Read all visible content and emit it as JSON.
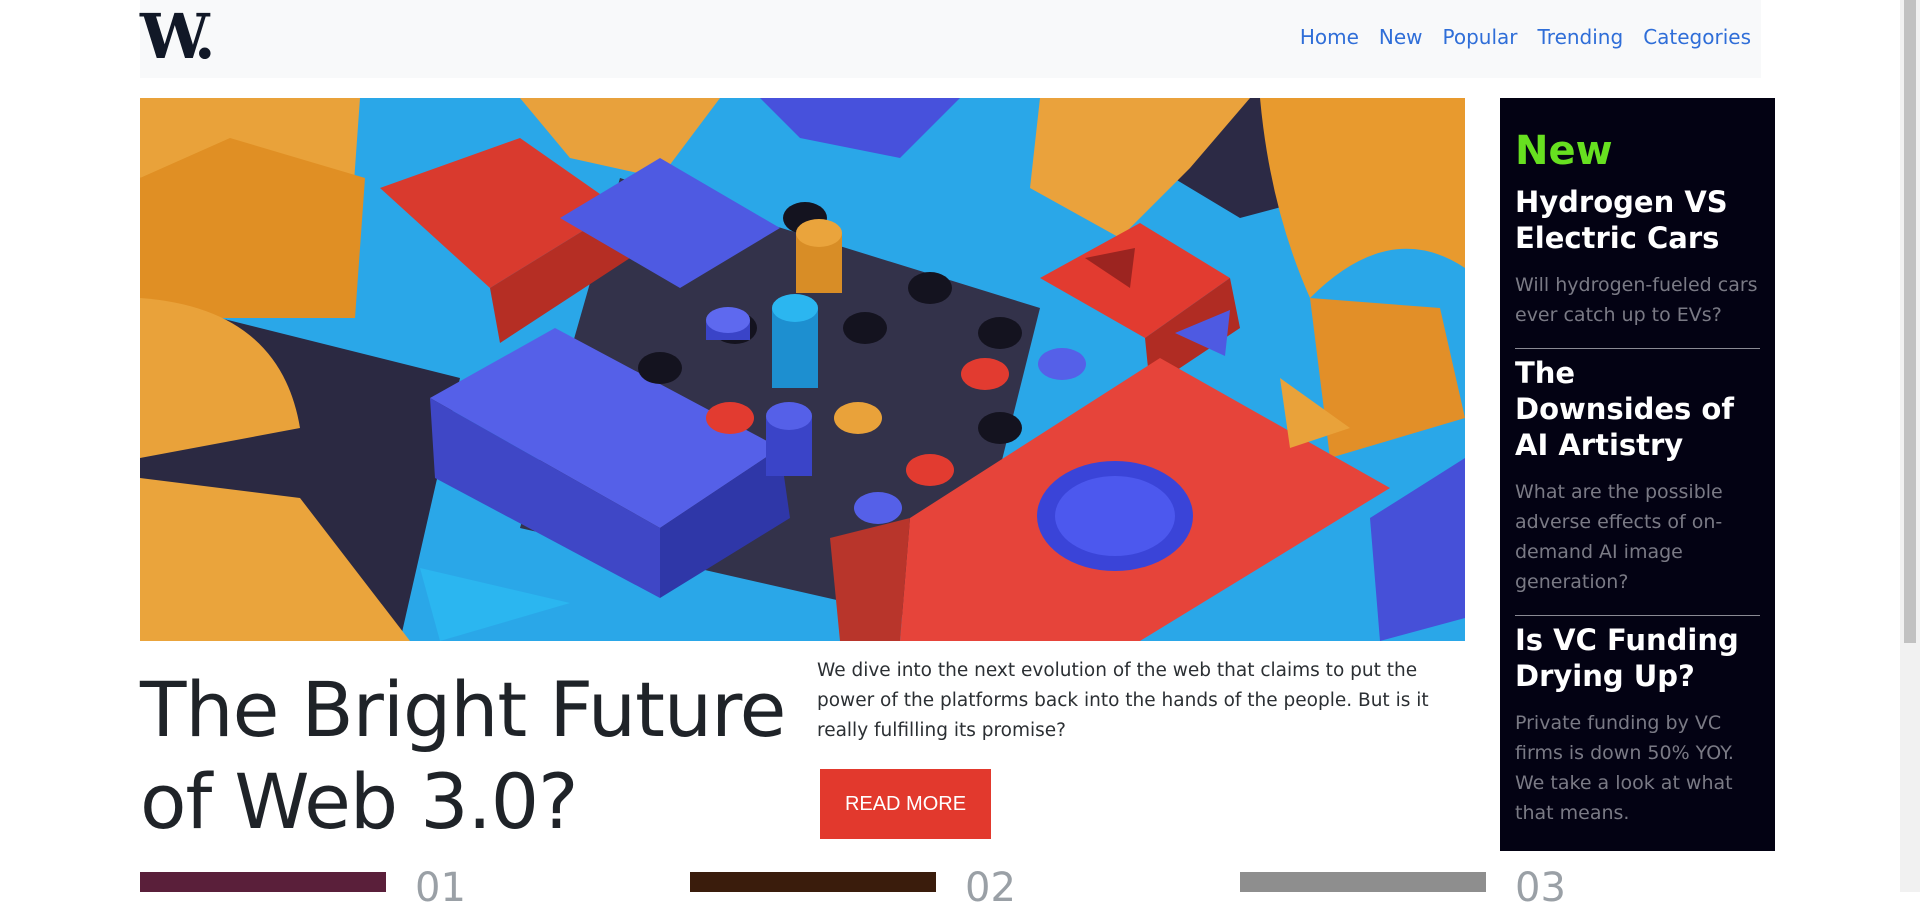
{
  "nav": {
    "logo": "W.",
    "links": [
      "Home",
      "New",
      "Popular",
      "Trending",
      "Categories"
    ]
  },
  "hero": {
    "title": "The Bright Future of Web 3.0?",
    "description": "We dive into the next evolution of the web that claims to put the power of the platforms back into the hands of the people. But is it really fulfilling its promise?",
    "button": "READ MORE"
  },
  "sidebar": {
    "heading": "New",
    "items": [
      {
        "title": "Hydrogen VS Electric Cars",
        "desc": "Will hydrogen-fueled cars ever catch up to EVs?"
      },
      {
        "title": "The Downsides of AI Artistry",
        "desc": "What are the possible adverse effects of on-demand AI image generation?"
      },
      {
        "title": "Is VC Funding Drying Up?",
        "desc": "Private funding by VC firms is down 50% YOY. We take a look at what that means."
      }
    ]
  },
  "bottom": {
    "numbers": [
      "01",
      "02",
      "03"
    ]
  },
  "colors": {
    "accent_nav": "#2f6ed8",
    "button": "#e2392d",
    "sidebar_bg": "#030213",
    "sidebar_heading": "#67e020"
  }
}
